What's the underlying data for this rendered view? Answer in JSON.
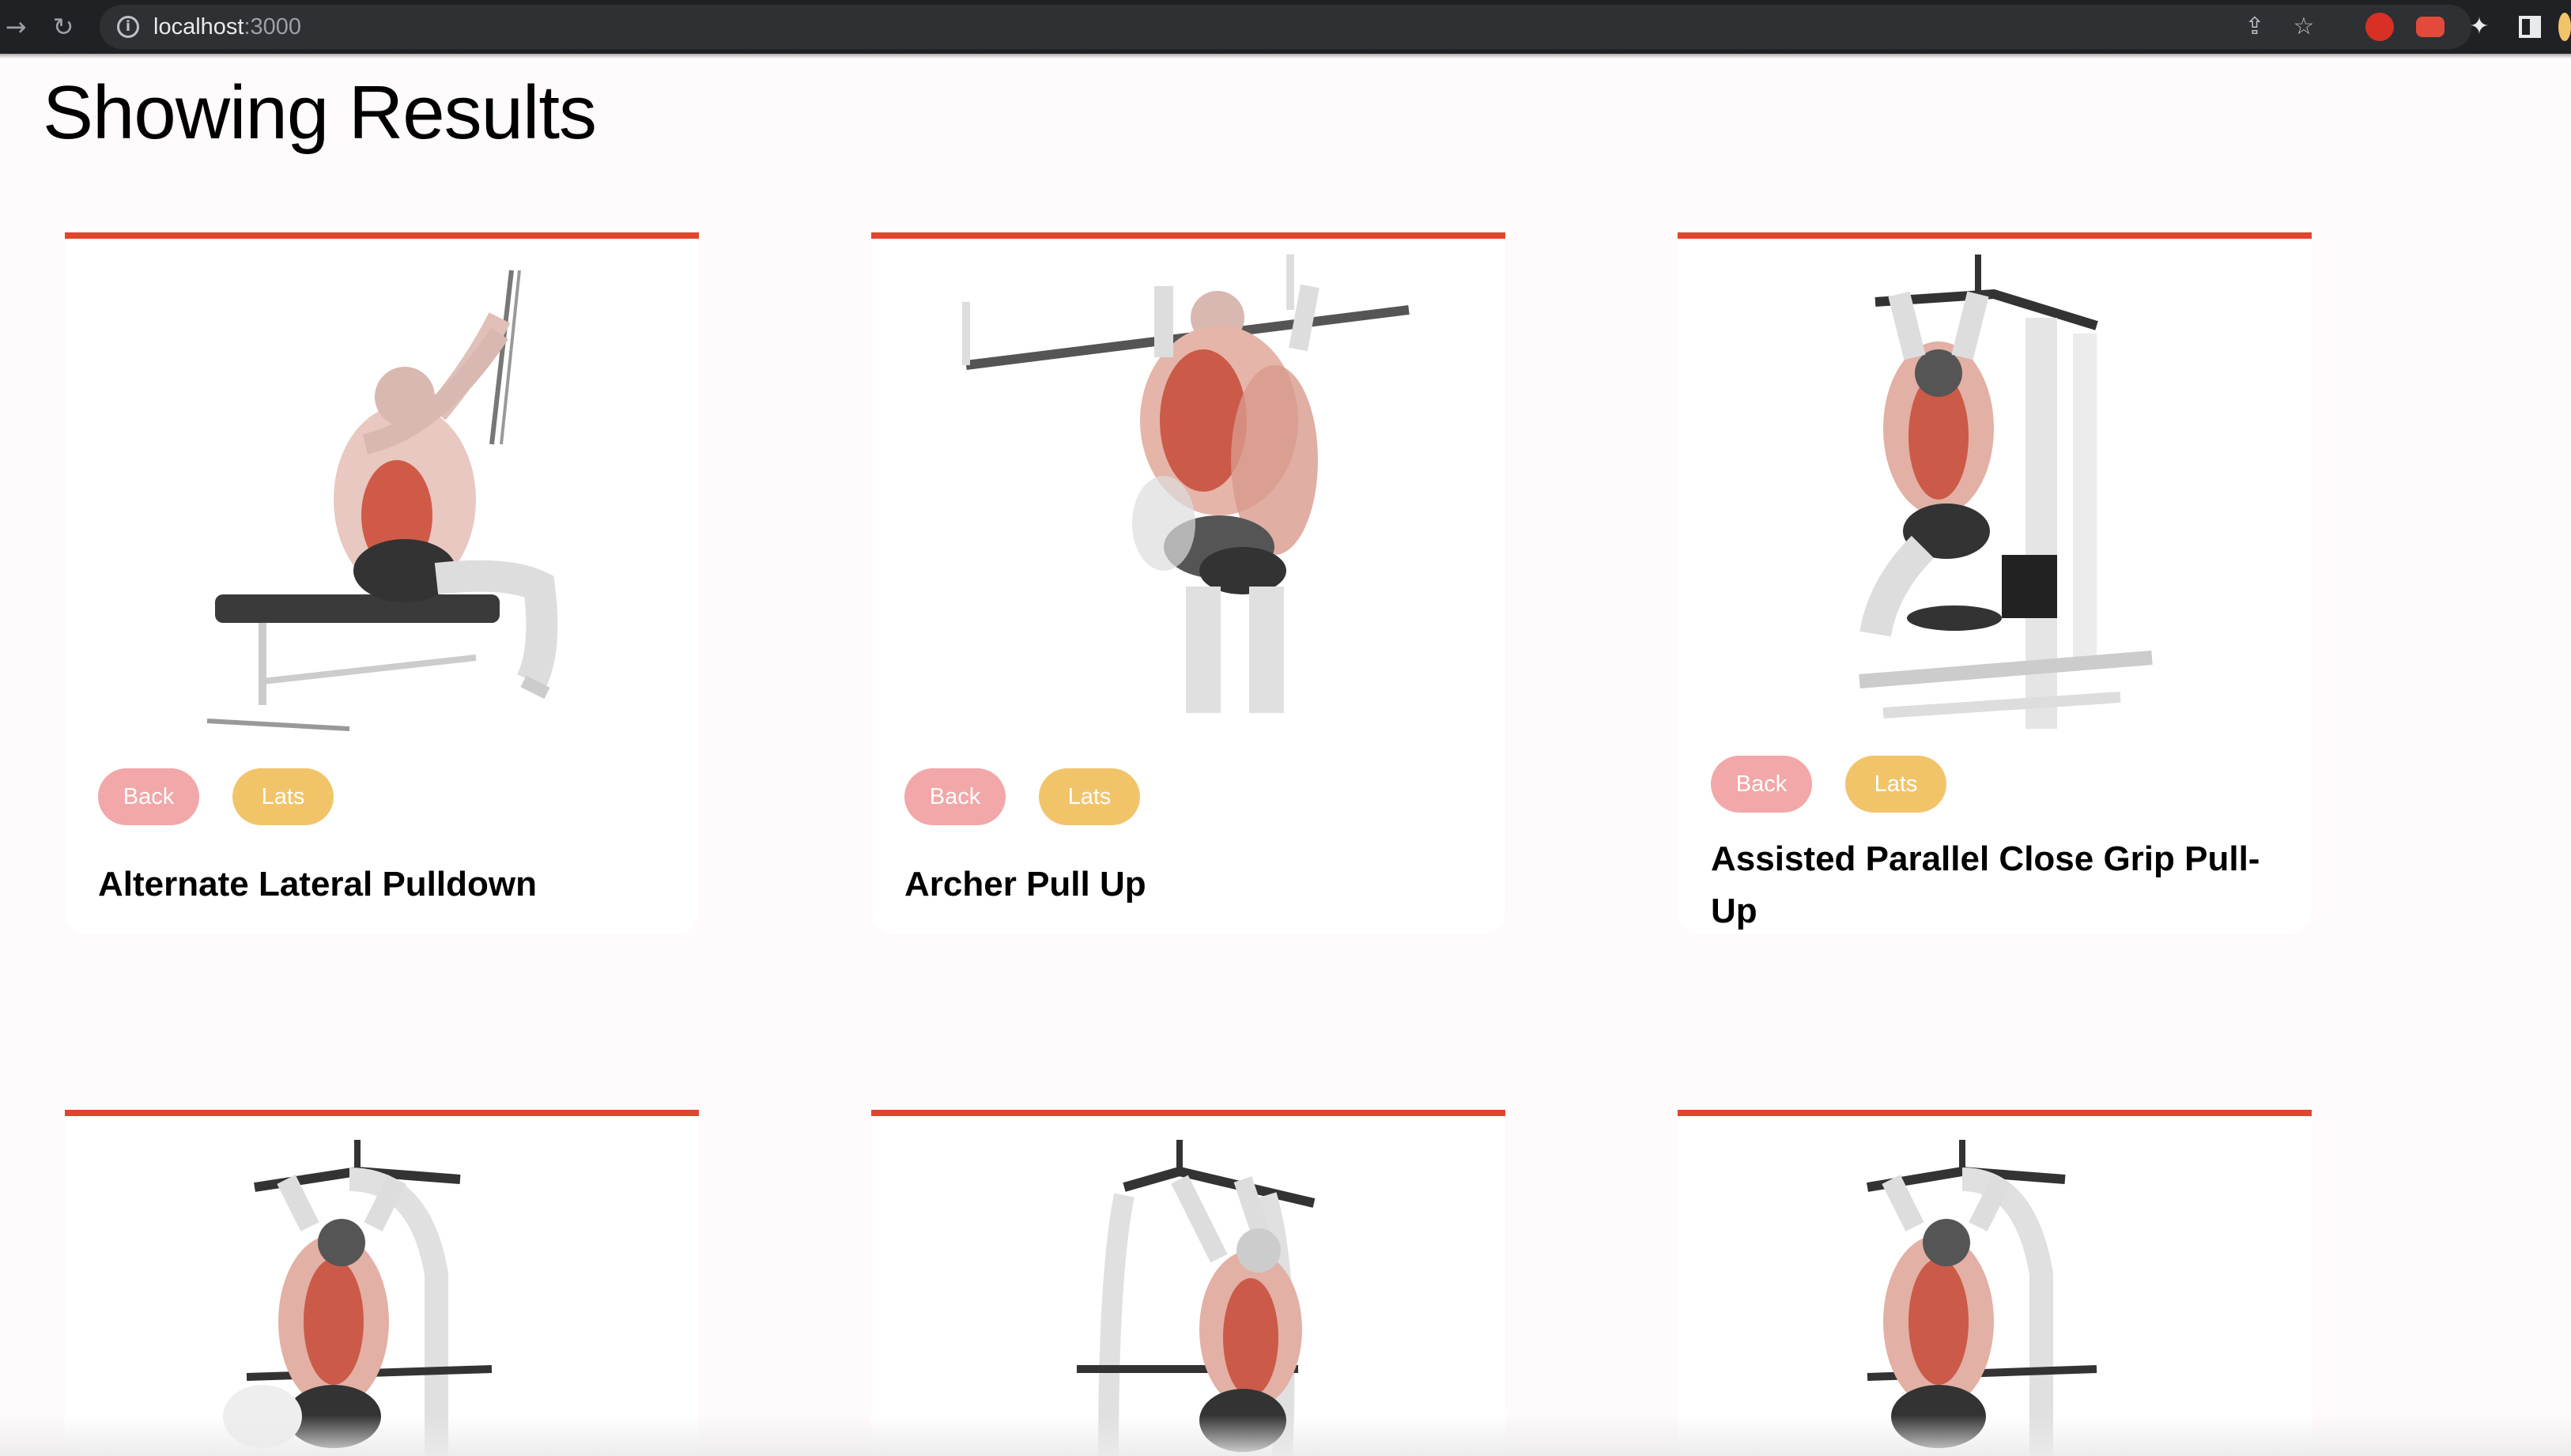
{
  "browser": {
    "url_host": "localhost",
    "url_port": ":3000"
  },
  "page": {
    "title": "Showing Results"
  },
  "colors": {
    "accent": "#e0452d",
    "tag_back": "#f2a7a8",
    "tag_lats": "#f2c46a",
    "background": "#fffafb"
  },
  "exercises": [
    {
      "name": "Alternate Lateral Pulldown",
      "tags": [
        "Back",
        "Lats"
      ],
      "image": "lat-pulldown-illustration"
    },
    {
      "name": "Archer Pull Up",
      "tags": [
        "Back",
        "Lats"
      ],
      "image": "pull-up-illustration"
    },
    {
      "name": "Assisted Parallel Close Grip Pull-Up",
      "tags": [
        "Back",
        "Lats"
      ],
      "image": "assisted-pull-up-machine-illustration"
    },
    {
      "name": "",
      "tags": [],
      "image": "assisted-pull-up-machine-illustration"
    },
    {
      "name": "",
      "tags": [],
      "image": "assisted-pull-up-machine-illustration"
    },
    {
      "name": "",
      "tags": [],
      "image": "assisted-pull-up-machine-illustration"
    }
  ]
}
